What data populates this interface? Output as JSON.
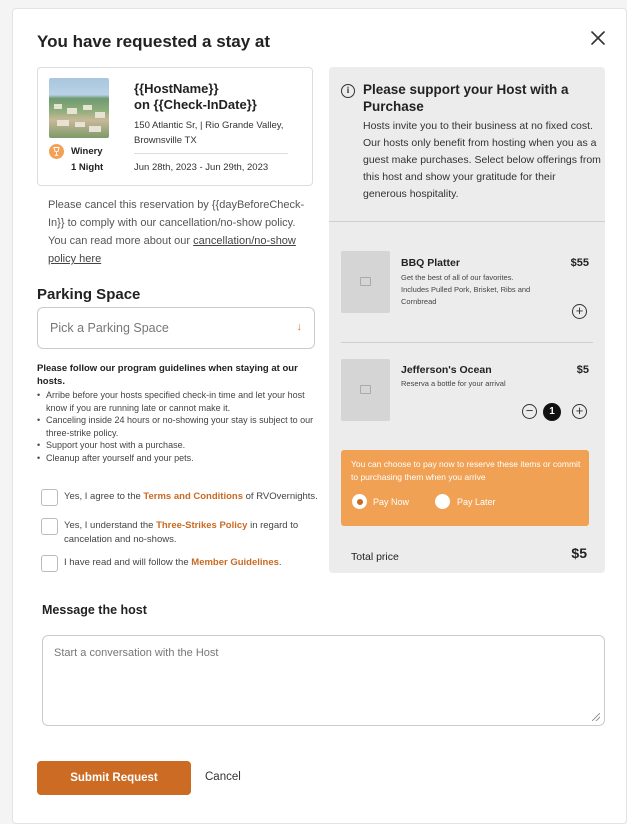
{
  "modal": {
    "title": "You have requested a stay at",
    "close_icon": "close-icon"
  },
  "booking": {
    "host_name": "{{HostName}}",
    "check_in": "on {{Check-InDate}}",
    "address_line1": "150 Atlantic Sr, | Rio Grande Valley,",
    "address_line2": "Brownsville TX",
    "category": "Winery",
    "category_icon": "wine-glass-icon",
    "nights": "1 Night",
    "dates": "Jun 28th, 2023 - Jun 29th, 2023"
  },
  "cancellation": {
    "text": "Please cancel this reservation by {{dayBeforeCheck-In}} to comply with our cancellation/no-show policy. You can read more about our ",
    "link": "cancellation/no-show policy here"
  },
  "parking": {
    "heading": "Parking Space",
    "placeholder": "Pick a Parking Space",
    "arrow": "↓"
  },
  "guidelines": {
    "heading": "Please follow our program guidelines when staying at our hosts.",
    "items": [
      "Arribe before your hosts specified check-in time and let your host know if you are running late or cannot make it.",
      "Canceling inside 24 hours or no-showing your stay is subject to our three-strike policy.",
      "Support your host with a purchase.",
      "Cleanup after yourself and your pets."
    ]
  },
  "agreements": [
    {
      "pre": "Yes, I agree to the ",
      "link": "Terms and Conditions",
      "post": " of RVOvernights."
    },
    {
      "pre": "Yes, I understand the ",
      "link": "Three-Strikes Policy",
      "post": " in regard to cancelation and no-shows."
    },
    {
      "pre": "I have read and will follow the ",
      "link": "Member Guidelines",
      "post": "."
    }
  ],
  "support": {
    "icon": "info-icon",
    "heading": "Please support your Host with a Purchase",
    "body": "Hosts invite you to their business at no fixed cost. Our hosts only benefit from hosting when you as a guest make purchases. Select below offerings from this host and show your gratitude for their generous hospitality."
  },
  "offerings": [
    {
      "name": "BBQ Platter",
      "price": "$55",
      "description": "Get the best of all of our favorites. Includes Pulled Pork, Brisket, Ribs and Cornbread",
      "quantity": 0
    },
    {
      "name": "Jefferson's Ocean",
      "price": "$5",
      "description": "Reserva a bottle for your arrival",
      "quantity": 1
    }
  ],
  "payment": {
    "note": "You can choose to pay now to reserve these items or commit to purchasing them when you arrive",
    "pay_now": "Pay Now",
    "pay_later": "Pay Later",
    "selected": "pay_now"
  },
  "total": {
    "label": "Total price",
    "value": "$5"
  },
  "message": {
    "heading": "Message the host",
    "placeholder": "Start a conversation with the Host"
  },
  "actions": {
    "submit": "Submit Request",
    "cancel": "Cancel"
  },
  "colors": {
    "accent": "#cc6b24",
    "pay_box": "#f0a154",
    "panel_bg": "#ececec"
  }
}
